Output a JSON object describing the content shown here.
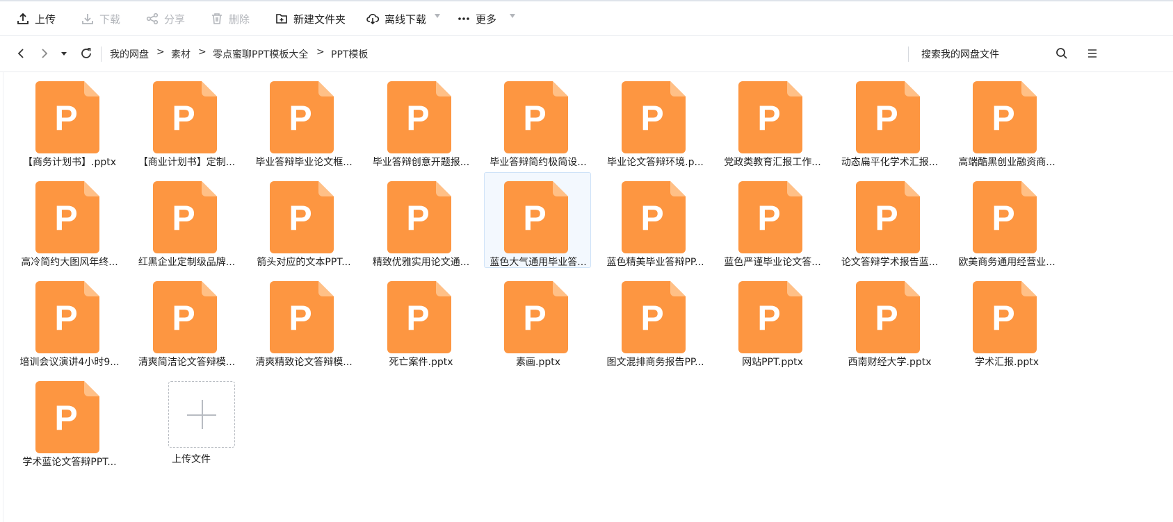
{
  "toolbar": {
    "upload": "上传",
    "download": "下载",
    "share": "分享",
    "delete": "删除",
    "new_folder": "新建文件夹",
    "offline_download": "离线下载",
    "more": "更多"
  },
  "breadcrumb": [
    "我的网盘",
    "素材",
    "零点蜜聊PPT模板大全",
    "PPT模板"
  ],
  "breadcrumb_sep": ">",
  "search": {
    "placeholder": "搜索我的网盘文件"
  },
  "colors": {
    "file_icon": "#fd9641",
    "file_icon_fold": "#ffc087",
    "selected_bg": "#f3f8fe"
  },
  "files": [
    {
      "name": "【商务计划书】.pptx"
    },
    {
      "name": "【商业计划书】定制..."
    },
    {
      "name": "毕业答辩毕业论文框..."
    },
    {
      "name": "毕业答辩创意开题报..."
    },
    {
      "name": "毕业答辩简约极简设..."
    },
    {
      "name": "毕业论文答辩环境.p..."
    },
    {
      "name": "党政类教育汇报工作..."
    },
    {
      "name": "动态扁平化学术汇报..."
    },
    {
      "name": "高端酷黑创业融资商..."
    },
    {
      "name": "高冷简约大图风年终..."
    },
    {
      "name": "红黑企业定制级品牌..."
    },
    {
      "name": "箭头对应的文本PPT..."
    },
    {
      "name": "精致优雅实用论文通..."
    },
    {
      "name": "蓝色大气通用毕业答..."
    },
    {
      "name": "蓝色精美毕业答辩PP..."
    },
    {
      "name": "蓝色严谨毕业论文答..."
    },
    {
      "name": "论文答辩学术报告蓝..."
    },
    {
      "name": "欧美商务通用经营业..."
    },
    {
      "name": "培训会议演讲4小时9..."
    },
    {
      "name": "清爽简洁论文答辩模..."
    },
    {
      "name": "清爽精致论文答辩模..."
    },
    {
      "name": "死亡案件.pptx"
    },
    {
      "name": "素画.pptx"
    },
    {
      "name": "图文混排商务报告PP..."
    },
    {
      "name": "网站PPT.pptx"
    },
    {
      "name": "西南财经大学.pptx"
    },
    {
      "name": "学术汇报.pptx"
    },
    {
      "name": "学术蓝论文答辩PPT..."
    }
  ],
  "file_icon_letter": "P",
  "selected_index": 13,
  "upload_tile": {
    "label": "上传文件"
  }
}
